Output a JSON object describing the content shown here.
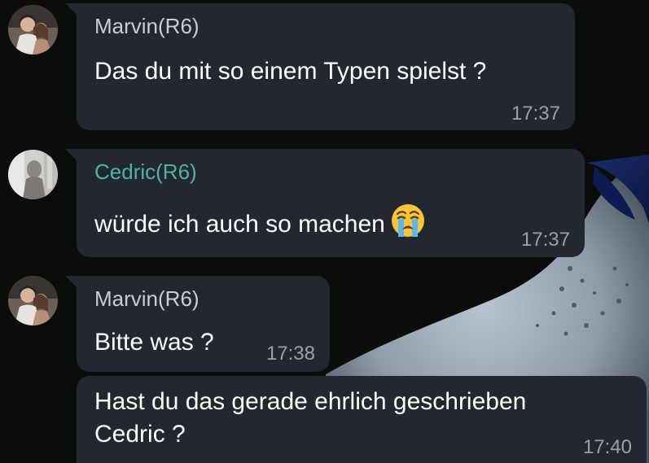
{
  "colors": {
    "background": "#0a0d0a",
    "bubble": "#23272f",
    "sender_marvin": "#c9ced6",
    "sender_cedric": "#4fb3a3",
    "message_text": "#ffffff",
    "timestamp": "#9aa1ad"
  },
  "messages": [
    {
      "sender": "Marvin(R6)",
      "text": "Das du mit so einem Typen spielst ?",
      "time": "17:37",
      "avatar": "avatar-marvin"
    },
    {
      "sender": "Cedric(R6)",
      "text": "würde ich auch so machen",
      "emoji": "loudly-crying-face-icon",
      "time": "17:37",
      "avatar": "avatar-cedric"
    },
    {
      "sender": "Marvin(R6)",
      "text": "Bitte was ?",
      "time": "17:38",
      "avatar": "avatar-marvin"
    },
    {
      "text_line1": "Hast du das gerade ehrlich geschrieben",
      "text_line2": "Cedric ?",
      "time": "17:40"
    }
  ]
}
